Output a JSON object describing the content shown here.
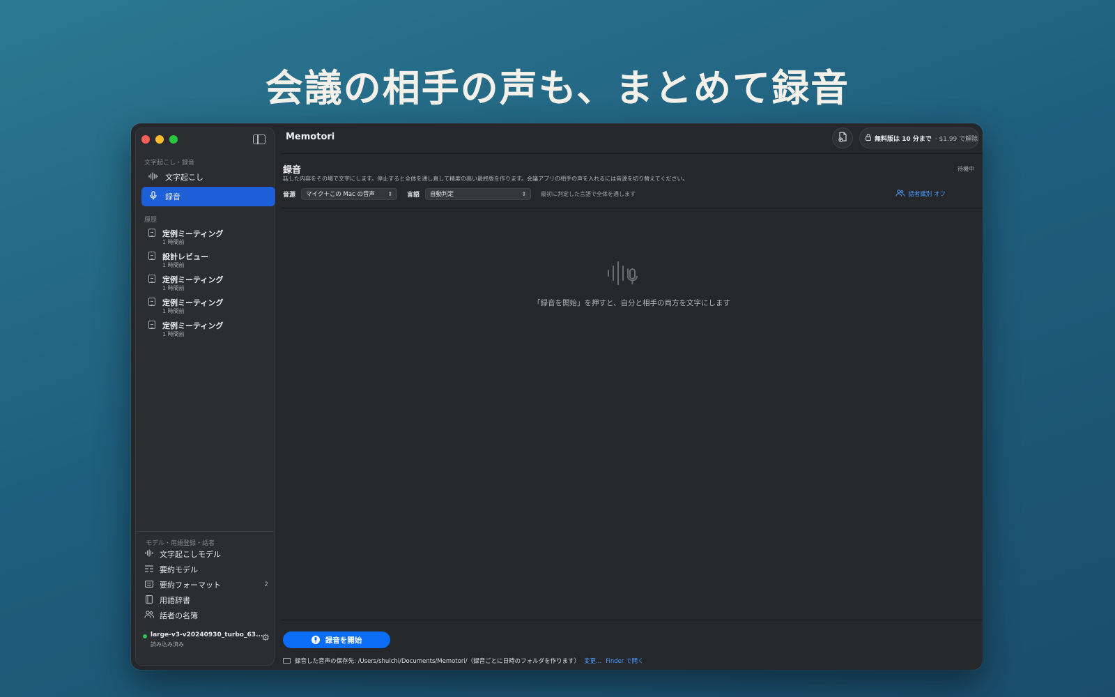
{
  "headline": "会議の相手の声も、まとめて録音",
  "sidebar": {
    "section_transcribe": "文字起こし・録音",
    "nav": [
      {
        "label": "文字起こし",
        "icon": "waveform-icon"
      },
      {
        "label": "録音",
        "icon": "microphone-icon"
      }
    ],
    "section_history": "履歴",
    "history": [
      {
        "title": "定例ミーティング",
        "time": "1 時間前"
      },
      {
        "title": "設計レビュー",
        "time": "1 時間前"
      },
      {
        "title": "定例ミーティング",
        "time": "1 時間前"
      },
      {
        "title": "定例ミーティング",
        "time": "1 時間前"
      },
      {
        "title": "定例ミーティング",
        "time": "1 時間前"
      }
    ],
    "section_settings": "モデル・用語登録・話者",
    "settings": [
      {
        "label": "文字起こしモデル",
        "icon": "waveform-icon",
        "count": ""
      },
      {
        "label": "要約モデル",
        "icon": "list-icon",
        "count": ""
      },
      {
        "label": "要約フォーマット",
        "icon": "format-icon",
        "count": "2"
      },
      {
        "label": "用語辞書",
        "icon": "book-icon",
        "count": ""
      },
      {
        "label": "話者の名簿",
        "icon": "people-icon",
        "count": ""
      }
    ],
    "model": {
      "name": "large-v3-v20240930_turbo_63...",
      "state": "読み込み済み"
    }
  },
  "toolbar": {
    "app_title": "Memotori",
    "unlock_bold": "無料版は 10 分まで",
    "unlock_rest": "· $1.99 で解除"
  },
  "recording": {
    "title": "録音",
    "status": "待機中",
    "description": "話した内容をその場で文字にします。停止すると全体を通し直して精度の高い最終版を作ります。会議アプリの相手の声を入れるには音源を切り替えてください。",
    "source_label": "音源",
    "source_value": "マイク＋この Mac の音声",
    "language_label": "言語",
    "language_value": "自動判定",
    "language_hint": "最初に判定した言語で全体を通します",
    "speaker_toggle": "話者識別 オフ",
    "empty_text": "「録音を開始」を押すと、自分と相手の両方を文字にします",
    "start_button": "録音を開始",
    "save_path": "録音した音声の保存先: /Users/shuichi/Documents/Memotori/（録音ごとに日時のフォルダを作ります）",
    "change_link": "変更...",
    "finder_link": "Finder で開く"
  },
  "colors": {
    "accent": "#0b6cf5",
    "active_nav": "#1c5fd6",
    "link": "#4a9cff",
    "status_dot": "#2fc457"
  }
}
